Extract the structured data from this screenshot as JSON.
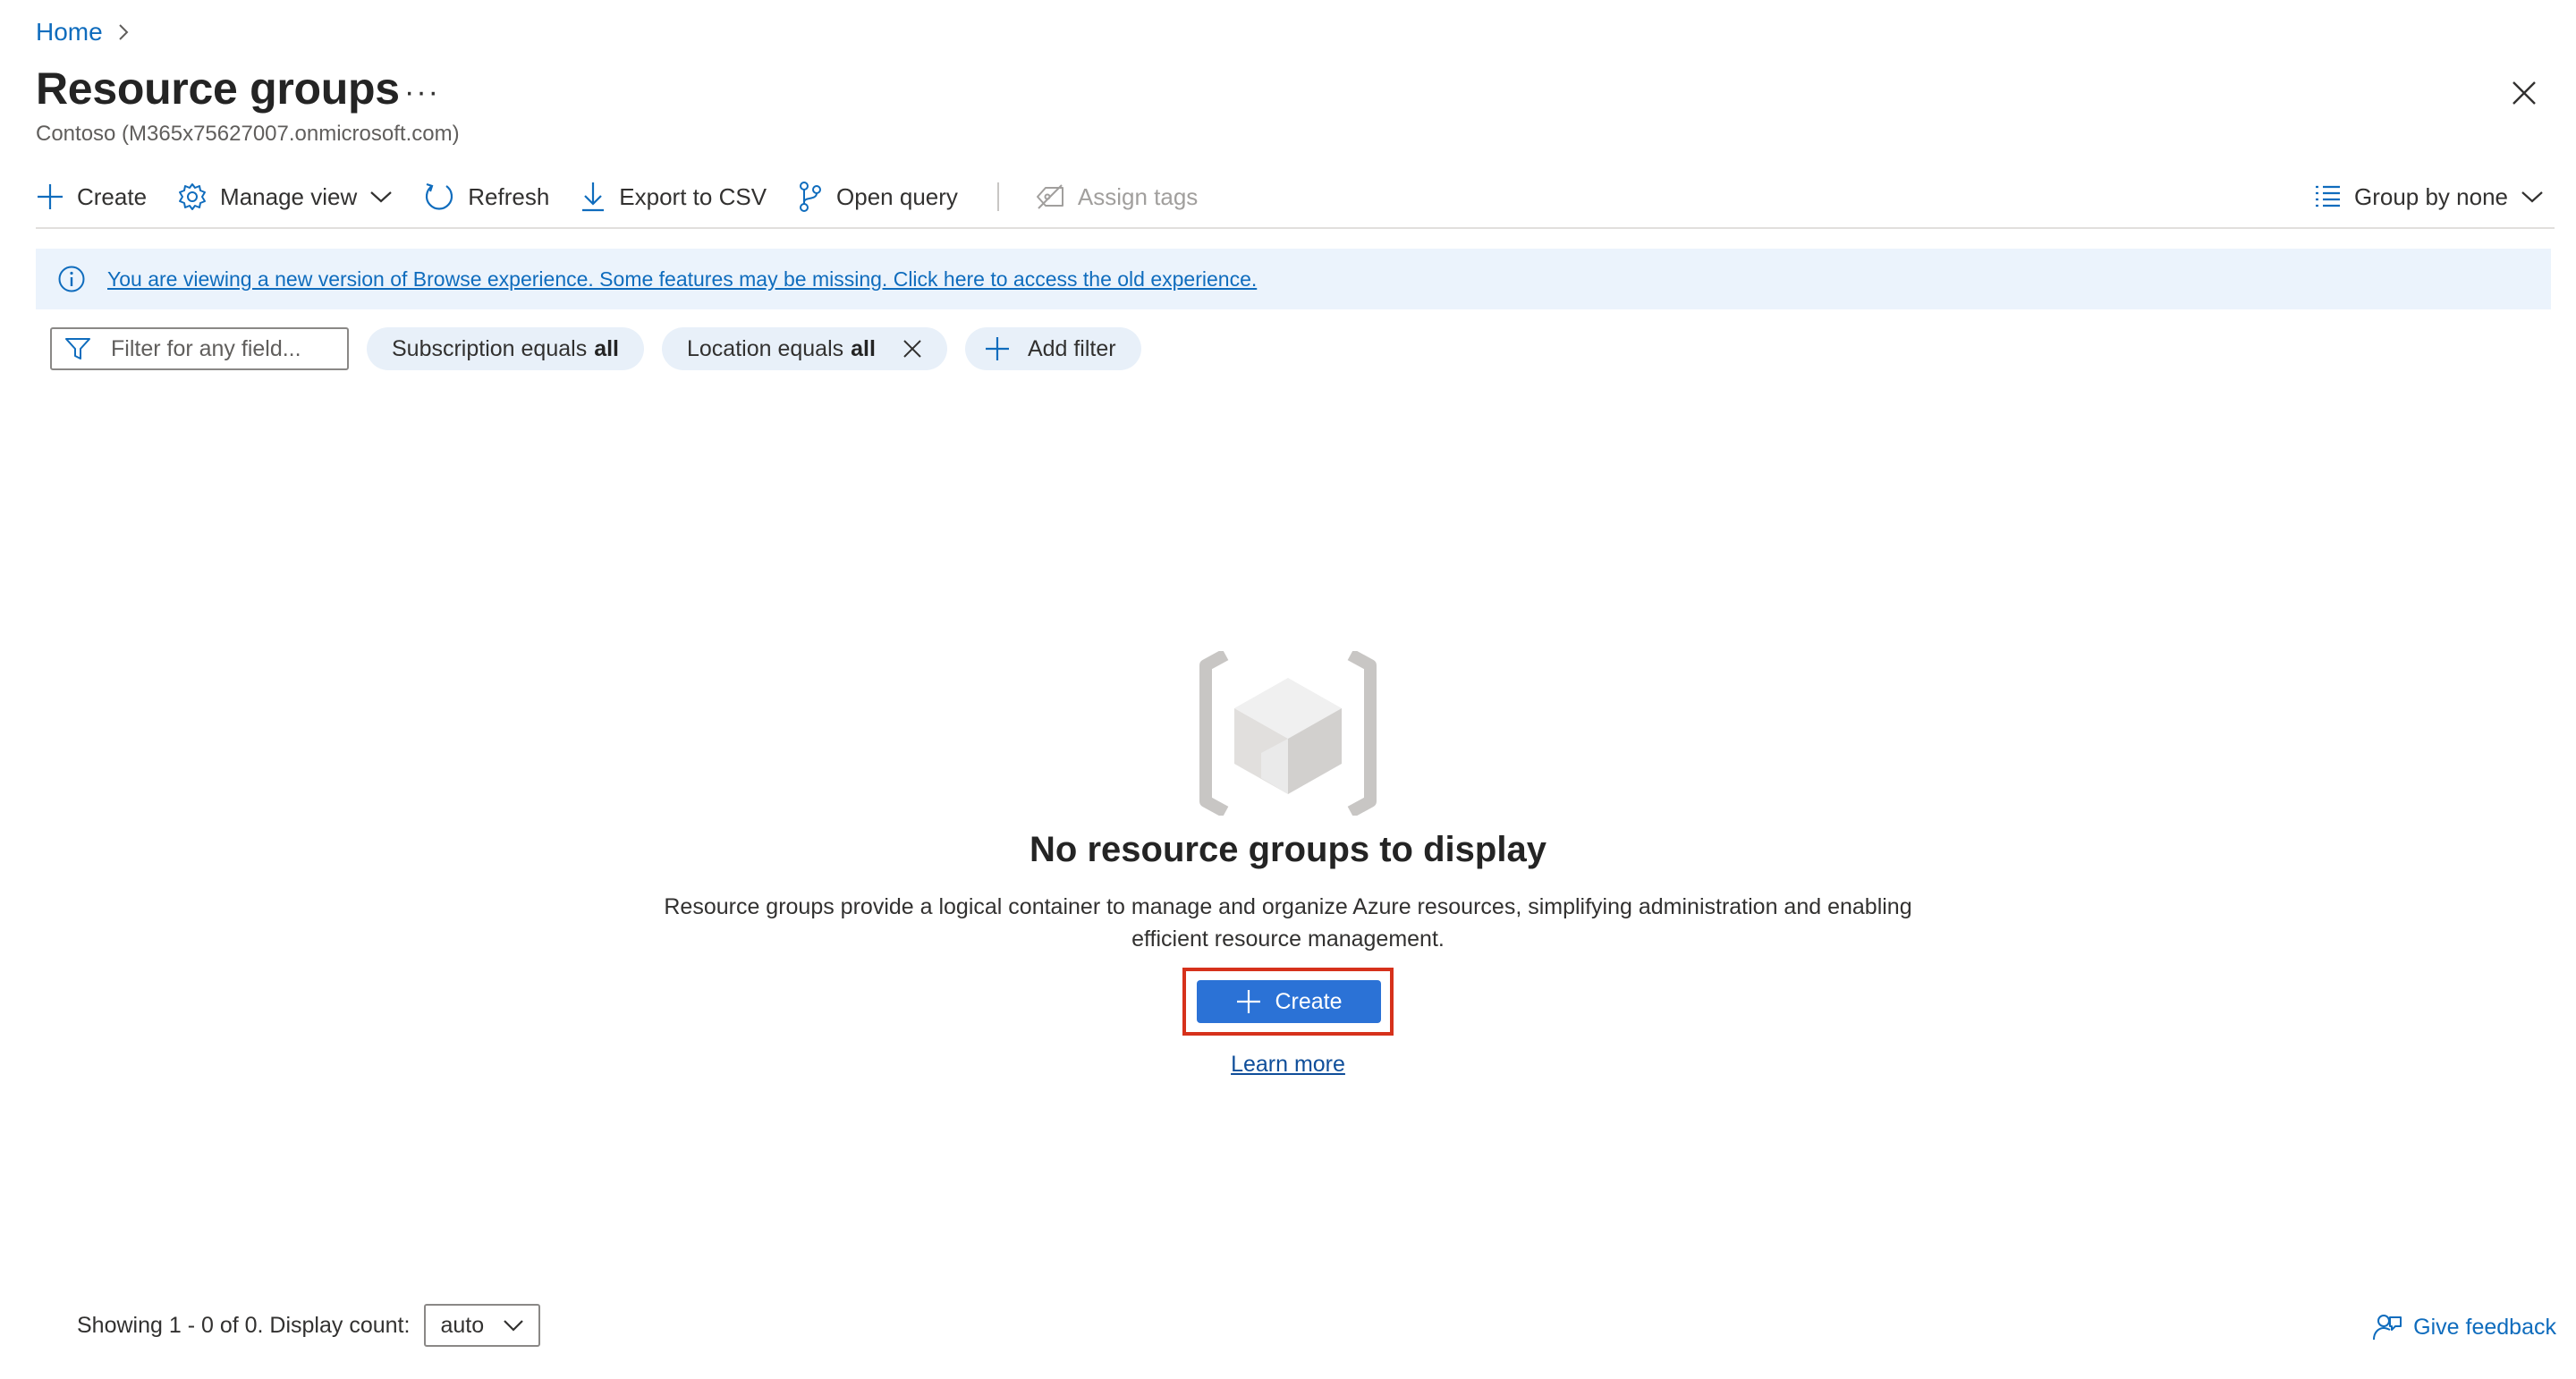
{
  "breadcrumb": {
    "home": "Home"
  },
  "header": {
    "title": "Resource groups",
    "more": "···",
    "subtitle": "Contoso (M365x75627007.onmicrosoft.com)"
  },
  "toolbar": {
    "create": "Create",
    "manage_view": "Manage view",
    "refresh": "Refresh",
    "export_csv": "Export to CSV",
    "open_query": "Open query",
    "assign_tags": "Assign tags",
    "group_by": "Group by none"
  },
  "banner": {
    "text": "You are viewing a new version of Browse experience. Some features may be missing. Click here to access the old experience."
  },
  "filters": {
    "placeholder": "Filter for any field...",
    "subscription_label": "Subscription equals",
    "subscription_value": "all",
    "location_label": "Location equals",
    "location_value": "all",
    "add_filter": "Add filter"
  },
  "empty_state": {
    "title": "No resource groups to display",
    "description": "Resource groups provide a logical container to manage and organize Azure resources, simplifying administration and enabling efficient resource management.",
    "create_button": "Create",
    "learn_more": "Learn more"
  },
  "footer": {
    "showing": "Showing 1 - 0 of 0. Display count:",
    "display_count": "auto",
    "give_feedback": "Give feedback"
  },
  "colors": {
    "accent": "#0f6cbd",
    "button": "#2b72d6",
    "banner_bg": "#ebf3fc",
    "pill_bg": "#e8f0f9",
    "highlight": "#d6311b"
  }
}
